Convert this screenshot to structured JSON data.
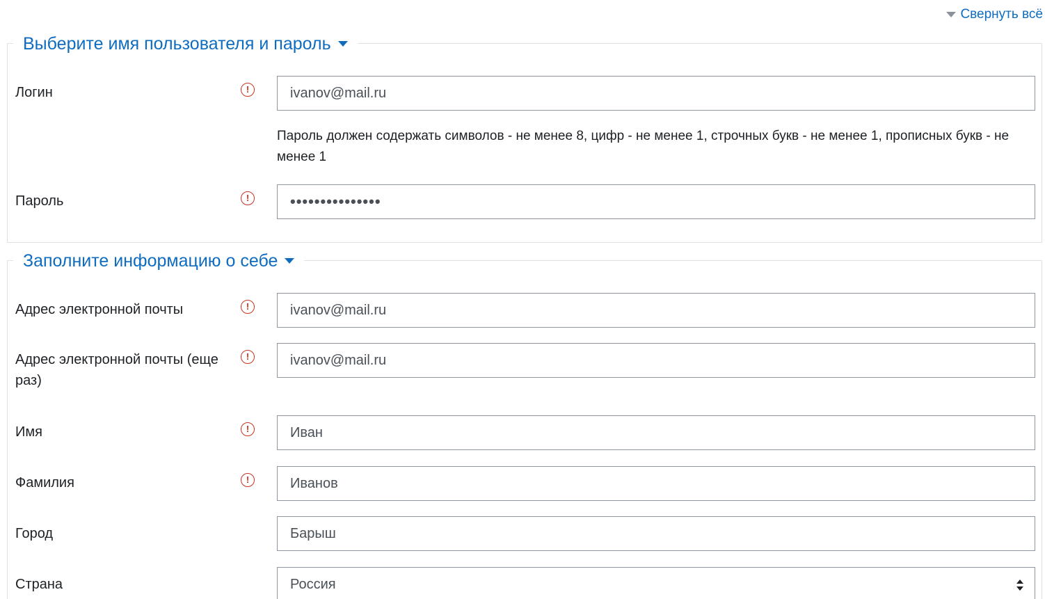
{
  "collapse_all": "Свернуть всё",
  "sections": {
    "account": {
      "title": "Выберите имя пользователя и пароль",
      "login": {
        "label": "Логин",
        "value": "ivanov@mail.ru"
      },
      "password_hint": "Пароль должен содержать символов - не менее 8, цифр - не менее 1, строчных букв - не менее 1, прописных букв - не менее 1",
      "password": {
        "label": "Пароль",
        "value": "•••••••••••••••"
      }
    },
    "profile": {
      "title": "Заполните информацию о себе",
      "email": {
        "label": "Адрес электронной почты",
        "value": "ivanov@mail.ru"
      },
      "email2": {
        "label": "Адрес электронной почты (еще раз)",
        "value": "ivanov@mail.ru"
      },
      "firstname": {
        "label": "Имя",
        "value": "Иван"
      },
      "lastname": {
        "label": "Фамилия",
        "value": "Иванов"
      },
      "city": {
        "label": "Город",
        "value": "Барыш"
      },
      "country": {
        "label": "Страна",
        "value": "Россия"
      }
    }
  },
  "required_icon": "!",
  "colors": {
    "link": "#0f6cbf",
    "required": "#ca3120",
    "border": "#8f959e",
    "text": "#1d2125"
  },
  "icons": {
    "required": "exclamation-circle-icon",
    "collapse": "caret-down-icon",
    "select": "sort-arrows-icon"
  }
}
